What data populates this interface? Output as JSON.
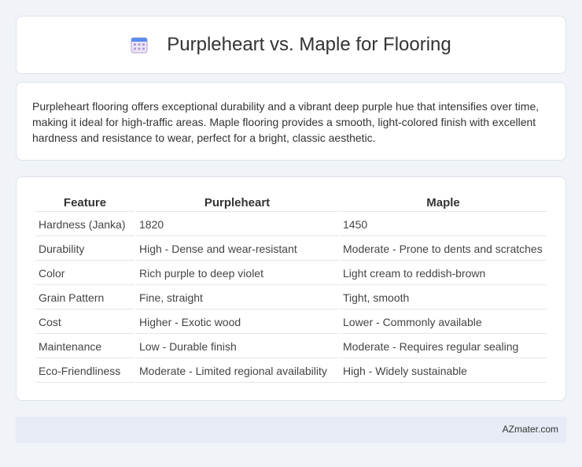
{
  "header": {
    "title": "Purpleheart vs. Maple for Flooring",
    "icon": "calendar-icon"
  },
  "summary": "Purpleheart flooring offers exceptional durability and a vibrant deep purple hue that intensifies over time, making it ideal for high-traffic areas. Maple flooring provides a smooth, light-colored finish with excellent hardness and resistance to wear, perfect for a bright, classic aesthetic.",
  "table": {
    "headers": [
      "Feature",
      "Purpleheart",
      "Maple"
    ],
    "rows": [
      [
        "Hardness (Janka)",
        "1820",
        "1450"
      ],
      [
        "Durability",
        "High - Dense and wear-resistant",
        "Moderate - Prone to dents and scratches"
      ],
      [
        "Color",
        "Rich purple to deep violet",
        "Light cream to reddish-brown"
      ],
      [
        "Grain Pattern",
        "Fine, straight",
        "Tight, smooth"
      ],
      [
        "Cost",
        "Higher - Exotic wood",
        "Lower - Commonly available"
      ],
      [
        "Maintenance",
        "Low - Durable finish",
        "Moderate - Requires regular sealing"
      ],
      [
        "Eco-Friendliness",
        "Moderate - Limited regional availability",
        "High - Widely sustainable"
      ]
    ]
  },
  "footer": {
    "brand": "AZmater.com"
  },
  "colors": {
    "background": "#f0f3f8",
    "footer_bg": "#e6ebf5",
    "icon_accent": "#5b8def",
    "icon_grid": "#b39ddb"
  }
}
